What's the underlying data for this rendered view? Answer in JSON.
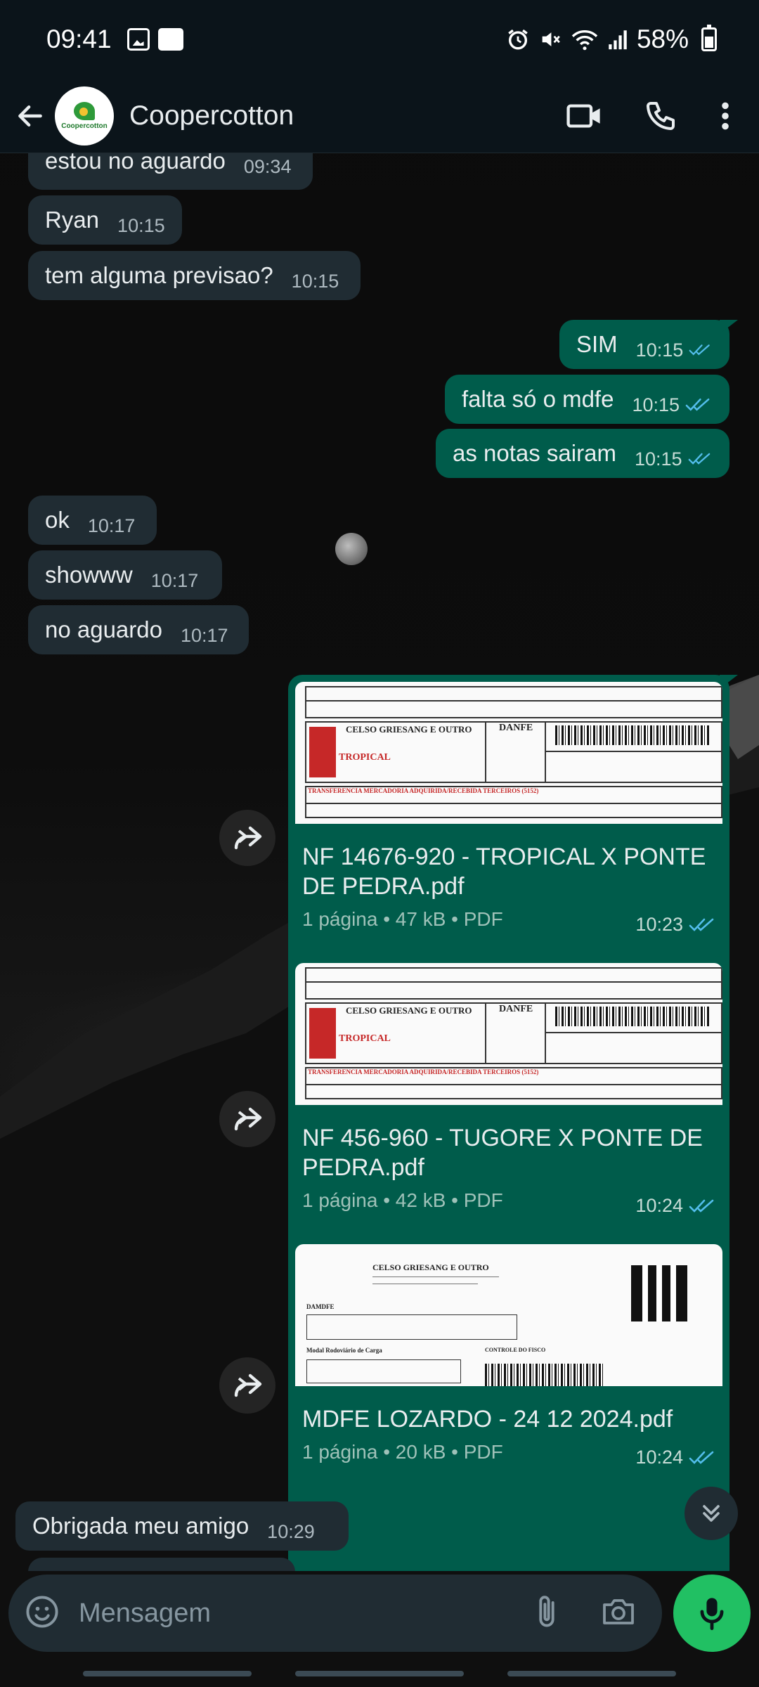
{
  "status_bar": {
    "time": "09:41",
    "battery": "58%",
    "icons": [
      "gallery-icon",
      "news-icon",
      "alarm-icon",
      "mute-icon",
      "wifi-icon",
      "signal-icon",
      "battery-icon"
    ]
  },
  "header": {
    "contact_name": "Coopercotton",
    "avatar_text": "Coopercotton",
    "actions": [
      "video-call-icon",
      "voice-call-icon",
      "more-options-icon"
    ]
  },
  "messages": [
    {
      "dir": "in",
      "text": "estou no aguardo",
      "time": "09:34"
    },
    {
      "dir": "in",
      "text": "Ryan",
      "time": "10:15"
    },
    {
      "dir": "in",
      "text": "tem alguma previsao?",
      "time": "10:15"
    },
    {
      "dir": "out",
      "text": "SIM",
      "time": "10:15",
      "status": "read"
    },
    {
      "dir": "out",
      "text": "falta só o mdfe",
      "time": "10:15",
      "status": "read"
    },
    {
      "dir": "out",
      "text": "as notas sairam",
      "time": "10:15",
      "status": "read"
    },
    {
      "dir": "in",
      "text": "ok",
      "time": "10:17"
    },
    {
      "dir": "in",
      "text": "showww",
      "time": "10:17"
    },
    {
      "dir": "in",
      "text": "no aguardo",
      "time": "10:17"
    },
    {
      "dir": "in",
      "text": "Obrigada meu amigo",
      "time": "10:29"
    }
  ],
  "documents": [
    {
      "name": "NF 14676-920 - TROPICAL X PONTE DE PEDRA.pdf",
      "meta": "1 página • 47 kB • PDF",
      "time": "10:23",
      "status": "read",
      "preview": {
        "company": "CELSO GRIESANG E OUTRO",
        "title": "DANFE",
        "nature": "TRANSFERENCIA MERCADORIA ADQUIRIDA/RECEBIDA TERCEIROS (5152)",
        "brand": "TROPICAL"
      }
    },
    {
      "name": "NF 456-960 - TUGORE X PONTE DE PEDRA.pdf",
      "meta": "1 página • 42 kB • PDF",
      "time": "10:24",
      "status": "read",
      "preview": {
        "company": "CELSO GRIESANG E OUTRO",
        "title": "DANFE",
        "nature": "TRANSFERENCIA MERCADORIA ADQUIRIDA/RECEBIDA TERCEIROS (5152)",
        "brand": "TROPICAL"
      }
    },
    {
      "name": "MDFE LOZARDO - 24 12 2024.pdf",
      "meta": "1 página • 20 kB • PDF",
      "time": "10:24",
      "status": "read",
      "preview": {
        "company": "CELSO GRIESANG E OUTRO",
        "title": "DAMDFE",
        "section": "Modal Rodoviário de Carga",
        "section2": "CONTROLE DO FISCO"
      }
    }
  ],
  "input": {
    "placeholder": "Mensagem"
  },
  "colors": {
    "incoming_bubble": "#202c33",
    "outgoing_bubble": "#005c4b",
    "read_tick": "#53bdeb",
    "mic_button": "#21c063"
  }
}
